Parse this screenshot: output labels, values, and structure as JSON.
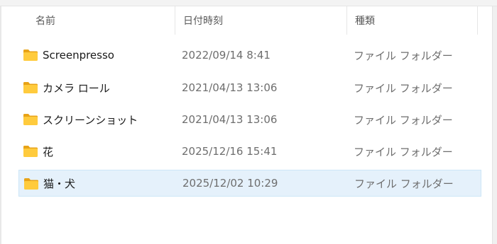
{
  "columns": {
    "name": "名前",
    "date": "日付時刻",
    "type": "種類"
  },
  "icon": "folder-icon",
  "colors": {
    "selection": "#e5f1fb",
    "folder_front": "#FFCB3D",
    "folder_back": "#E8A317"
  },
  "items": [
    {
      "name": "Screenpresso",
      "date": "2022/09/14 8:41",
      "type": "ファイル フォルダー",
      "selected": false
    },
    {
      "name": "カメラ ロール",
      "date": "2021/04/13 13:06",
      "type": "ファイル フォルダー",
      "selected": false
    },
    {
      "name": "スクリーンショット",
      "date": "2021/04/13 13:06",
      "type": "ファイル フォルダー",
      "selected": false
    },
    {
      "name": "花",
      "date": "2025/12/16 15:41",
      "type": "ファイル フォルダー",
      "selected": false
    },
    {
      "name": "猫・犬",
      "date": "2025/12/02 10:29",
      "type": "ファイル フォルダー",
      "selected": true
    }
  ]
}
